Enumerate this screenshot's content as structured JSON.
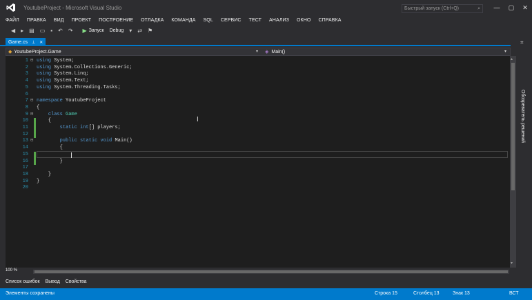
{
  "window": {
    "title": "YoutubeProject - Microsoft Visual Studio",
    "quick_launch_placeholder": "Быстрый запуск (Ctrl+Q)",
    "accent_color": "#007acc"
  },
  "menu": [
    "ФАЙЛ",
    "ПРАВКА",
    "ВИД",
    "ПРОЕКТ",
    "ПОСТРОЕНИЕ",
    "ОТЛАДКА",
    "КОМАНДА",
    "SQL",
    "СЕРВИС",
    "ТЕСТ",
    "АНАЛИЗ",
    "ОКНО",
    "СПРАВКА"
  ],
  "toolbar": {
    "start_label": "Запуск",
    "config_label": "Debug"
  },
  "tabs": [
    {
      "label": "Game.cs",
      "pin_icon": "pin-icon",
      "close_icon": "close-icon"
    }
  ],
  "navbar": {
    "type_label": "YoutubeProject.Game",
    "member_label": "Main()"
  },
  "editor": {
    "lines": [
      {
        "n": "1",
        "fold": "⊟",
        "tokens": [
          [
            "kw",
            "using"
          ],
          [
            "id",
            " System;"
          ]
        ]
      },
      {
        "n": "2",
        "fold": "",
        "tokens": [
          [
            "kw",
            "using"
          ],
          [
            "id",
            " System.Collections.Generic;"
          ]
        ]
      },
      {
        "n": "3",
        "fold": "",
        "tokens": [
          [
            "kw",
            "using"
          ],
          [
            "id",
            " System.Linq;"
          ]
        ]
      },
      {
        "n": "4",
        "fold": "",
        "tokens": [
          [
            "kw",
            "using"
          ],
          [
            "id",
            " System.Text;"
          ]
        ]
      },
      {
        "n": "5",
        "fold": "",
        "tokens": [
          [
            "kw",
            "using"
          ],
          [
            "id",
            " System.Threading.Tasks;"
          ]
        ]
      },
      {
        "n": "6",
        "fold": "",
        "tokens": []
      },
      {
        "n": "7",
        "fold": "⊟",
        "tokens": [
          [
            "kw",
            "namespace"
          ],
          [
            "id",
            " YoutubeProject"
          ]
        ]
      },
      {
        "n": "8",
        "fold": "",
        "tokens": [
          [
            "id",
            "{"
          ]
        ]
      },
      {
        "n": "9",
        "fold": "⊟",
        "tokens": [
          [
            "id",
            "    "
          ],
          [
            "kw",
            "class"
          ],
          [
            "id",
            " "
          ],
          [
            "ty",
            "Game"
          ]
        ]
      },
      {
        "n": "10",
        "fold": "",
        "tokens": [
          [
            "id",
            "    {"
          ]
        ]
      },
      {
        "n": "11",
        "fold": "",
        "tokens": [
          [
            "id",
            "        "
          ],
          [
            "kw",
            "static"
          ],
          [
            "id",
            " "
          ],
          [
            "kw",
            "int"
          ],
          [
            "id",
            "[] players;"
          ]
        ]
      },
      {
        "n": "12",
        "fold": "",
        "tokens": []
      },
      {
        "n": "13",
        "fold": "⊟",
        "tokens": [
          [
            "id",
            "        "
          ],
          [
            "kw",
            "public"
          ],
          [
            "id",
            " "
          ],
          [
            "kw",
            "static"
          ],
          [
            "id",
            " "
          ],
          [
            "kw",
            "void"
          ],
          [
            "id",
            " Main()"
          ]
        ]
      },
      {
        "n": "14",
        "fold": "",
        "tokens": [
          [
            "id",
            "        {"
          ]
        ]
      },
      {
        "n": "15",
        "fold": "",
        "tokens": [
          [
            "id",
            "            "
          ]
        ]
      },
      {
        "n": "16",
        "fold": "",
        "tokens": [
          [
            "id",
            "        }"
          ]
        ]
      },
      {
        "n": "17",
        "fold": "",
        "tokens": []
      },
      {
        "n": "18",
        "fold": "",
        "tokens": [
          [
            "id",
            "    }"
          ]
        ]
      },
      {
        "n": "19",
        "fold": "",
        "tokens": [
          [
            "id",
            "}"
          ]
        ]
      },
      {
        "n": "20",
        "fold": "",
        "tokens": []
      }
    ],
    "zoom": "100 %"
  },
  "sidebar": {
    "solution_explorer_label": "Обозреватель решений"
  },
  "bottom_tabs": [
    "Список ошибок",
    "Вывод",
    "Свойства"
  ],
  "status": {
    "message": "Элементы сохранены",
    "line": "Строка 15",
    "column": "Столбец 13",
    "char": "Знак 13",
    "mode": "ВСТ"
  }
}
